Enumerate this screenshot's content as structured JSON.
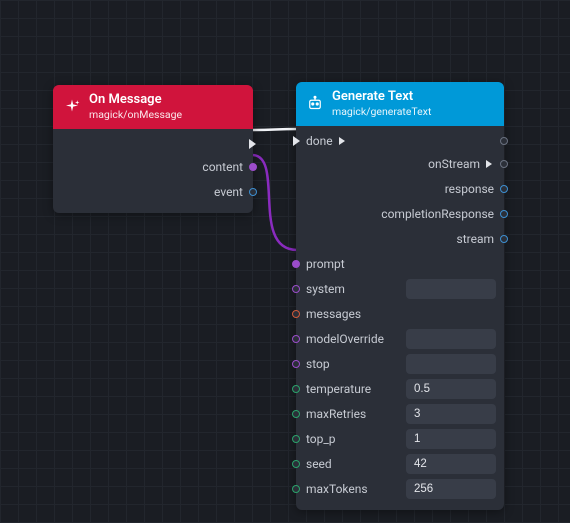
{
  "nodes": {
    "onMessage": {
      "title": "On Message",
      "subtitle": "magick/onMessage",
      "outputs": {
        "content": "content",
        "event": "event"
      }
    },
    "generateText": {
      "title": "Generate Text",
      "subtitle": "magick/generateText",
      "outputs": {
        "done": "done",
        "onStream": "onStream",
        "response": "response",
        "completionResponse": "completionResponse",
        "stream": "stream"
      },
      "inputs": {
        "prompt": "prompt",
        "system": {
          "label": "system",
          "value": ""
        },
        "messages": "messages",
        "modelOverride": {
          "label": "modelOverride",
          "value": ""
        },
        "stop": {
          "label": "stop",
          "value": ""
        },
        "temperature": {
          "label": "temperature",
          "value": "0.5"
        },
        "maxRetries": {
          "label": "maxRetries",
          "value": "3"
        },
        "top_p": {
          "label": "top_p",
          "value": "1"
        },
        "seed": {
          "label": "seed",
          "value": "42"
        },
        "maxTokens": {
          "label": "maxTokens",
          "value": "256"
        }
      }
    }
  }
}
